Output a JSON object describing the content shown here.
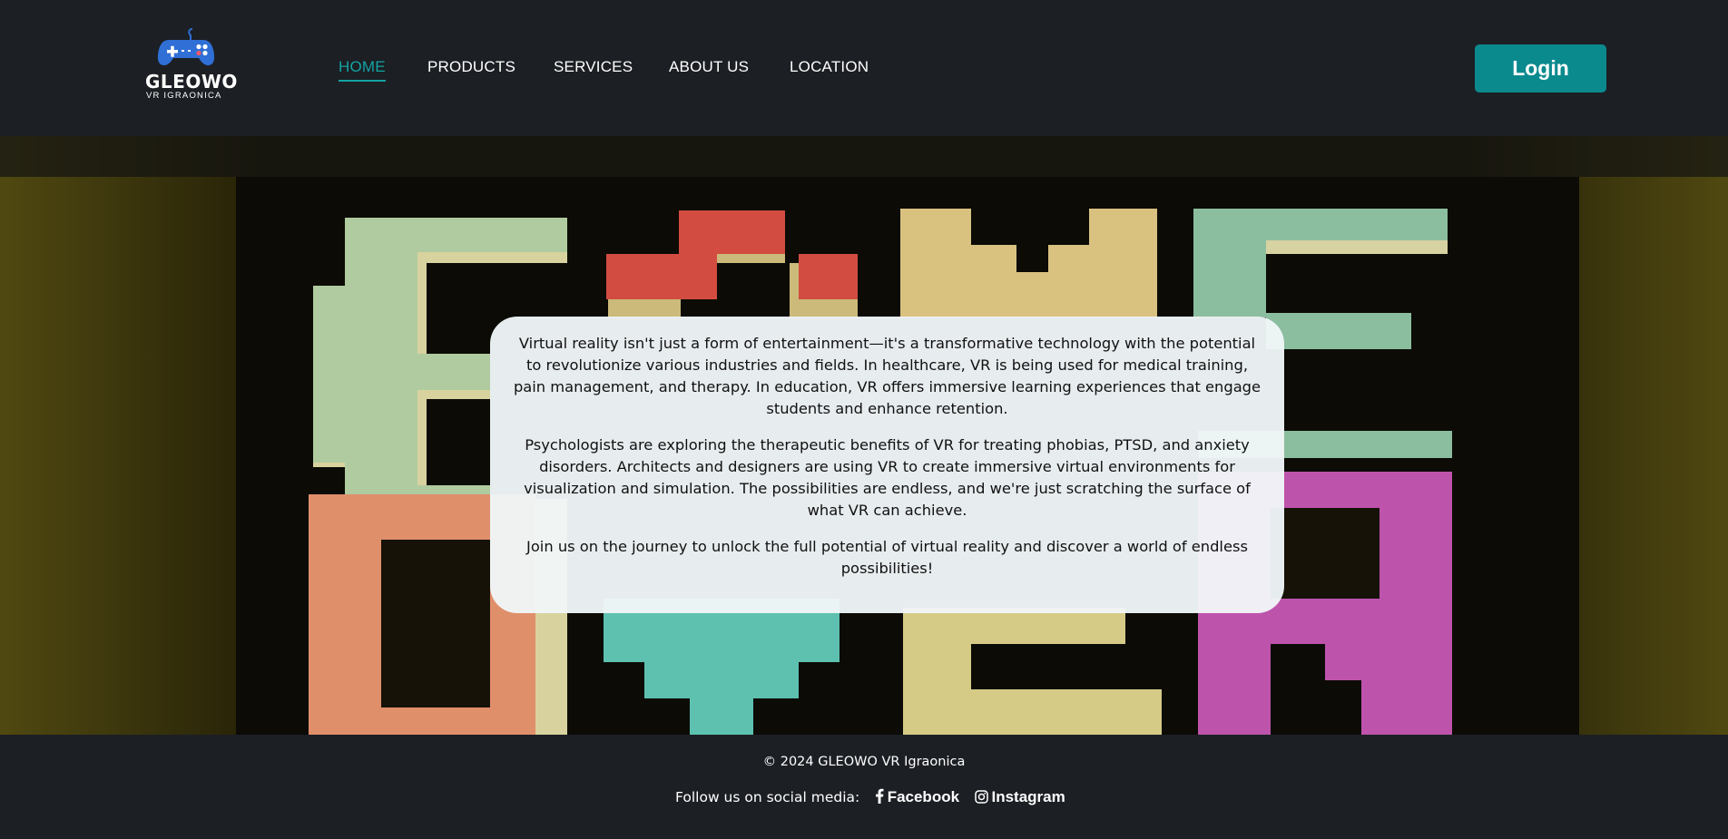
{
  "header": {
    "logo": {
      "brand": "GLEOWO",
      "tagline": "VR IGRAONICA"
    },
    "nav": [
      {
        "label": "HOME",
        "active": true
      },
      {
        "label": "PRODUCTS",
        "active": false
      },
      {
        "label": "SERVICES",
        "active": false
      },
      {
        "label": "ABOUT US",
        "active": false
      },
      {
        "label": "LOCATION",
        "active": false
      }
    ],
    "login_label": "Login"
  },
  "hero": {
    "paragraphs": [
      "Virtual reality isn't just a form of entertainment—it's a transformative technology with the potential to revolutionize various industries and fields. In healthcare, VR is being used for medical training, pain management, and therapy. In education, VR offers immersive learning experiences that engage students and enhance retention.",
      "Psychologists are exploring the therapeutic benefits of VR for treating phobias, PTSD, and anxiety disorders. Architects and designers are using VR to create immersive virtual environments for visualization and simulation. The possibilities are endless, and we're just scratching the surface of what VR can achieve.",
      "Join us on the journey to unlock the full potential of virtual reality and discover a world of endless possibilities!"
    ]
  },
  "footer": {
    "copyright": "© 2024 GLEOWO VR Igraonica",
    "social_label": "Follow us on social media:",
    "links": [
      {
        "label": "Facebook",
        "icon": "facebook-icon"
      },
      {
        "label": "Instagram",
        "icon": "instagram-icon"
      }
    ]
  },
  "colors": {
    "background": "#1c1f24",
    "accent": "#0b8a8e",
    "nav_active": "#14a3a3"
  }
}
